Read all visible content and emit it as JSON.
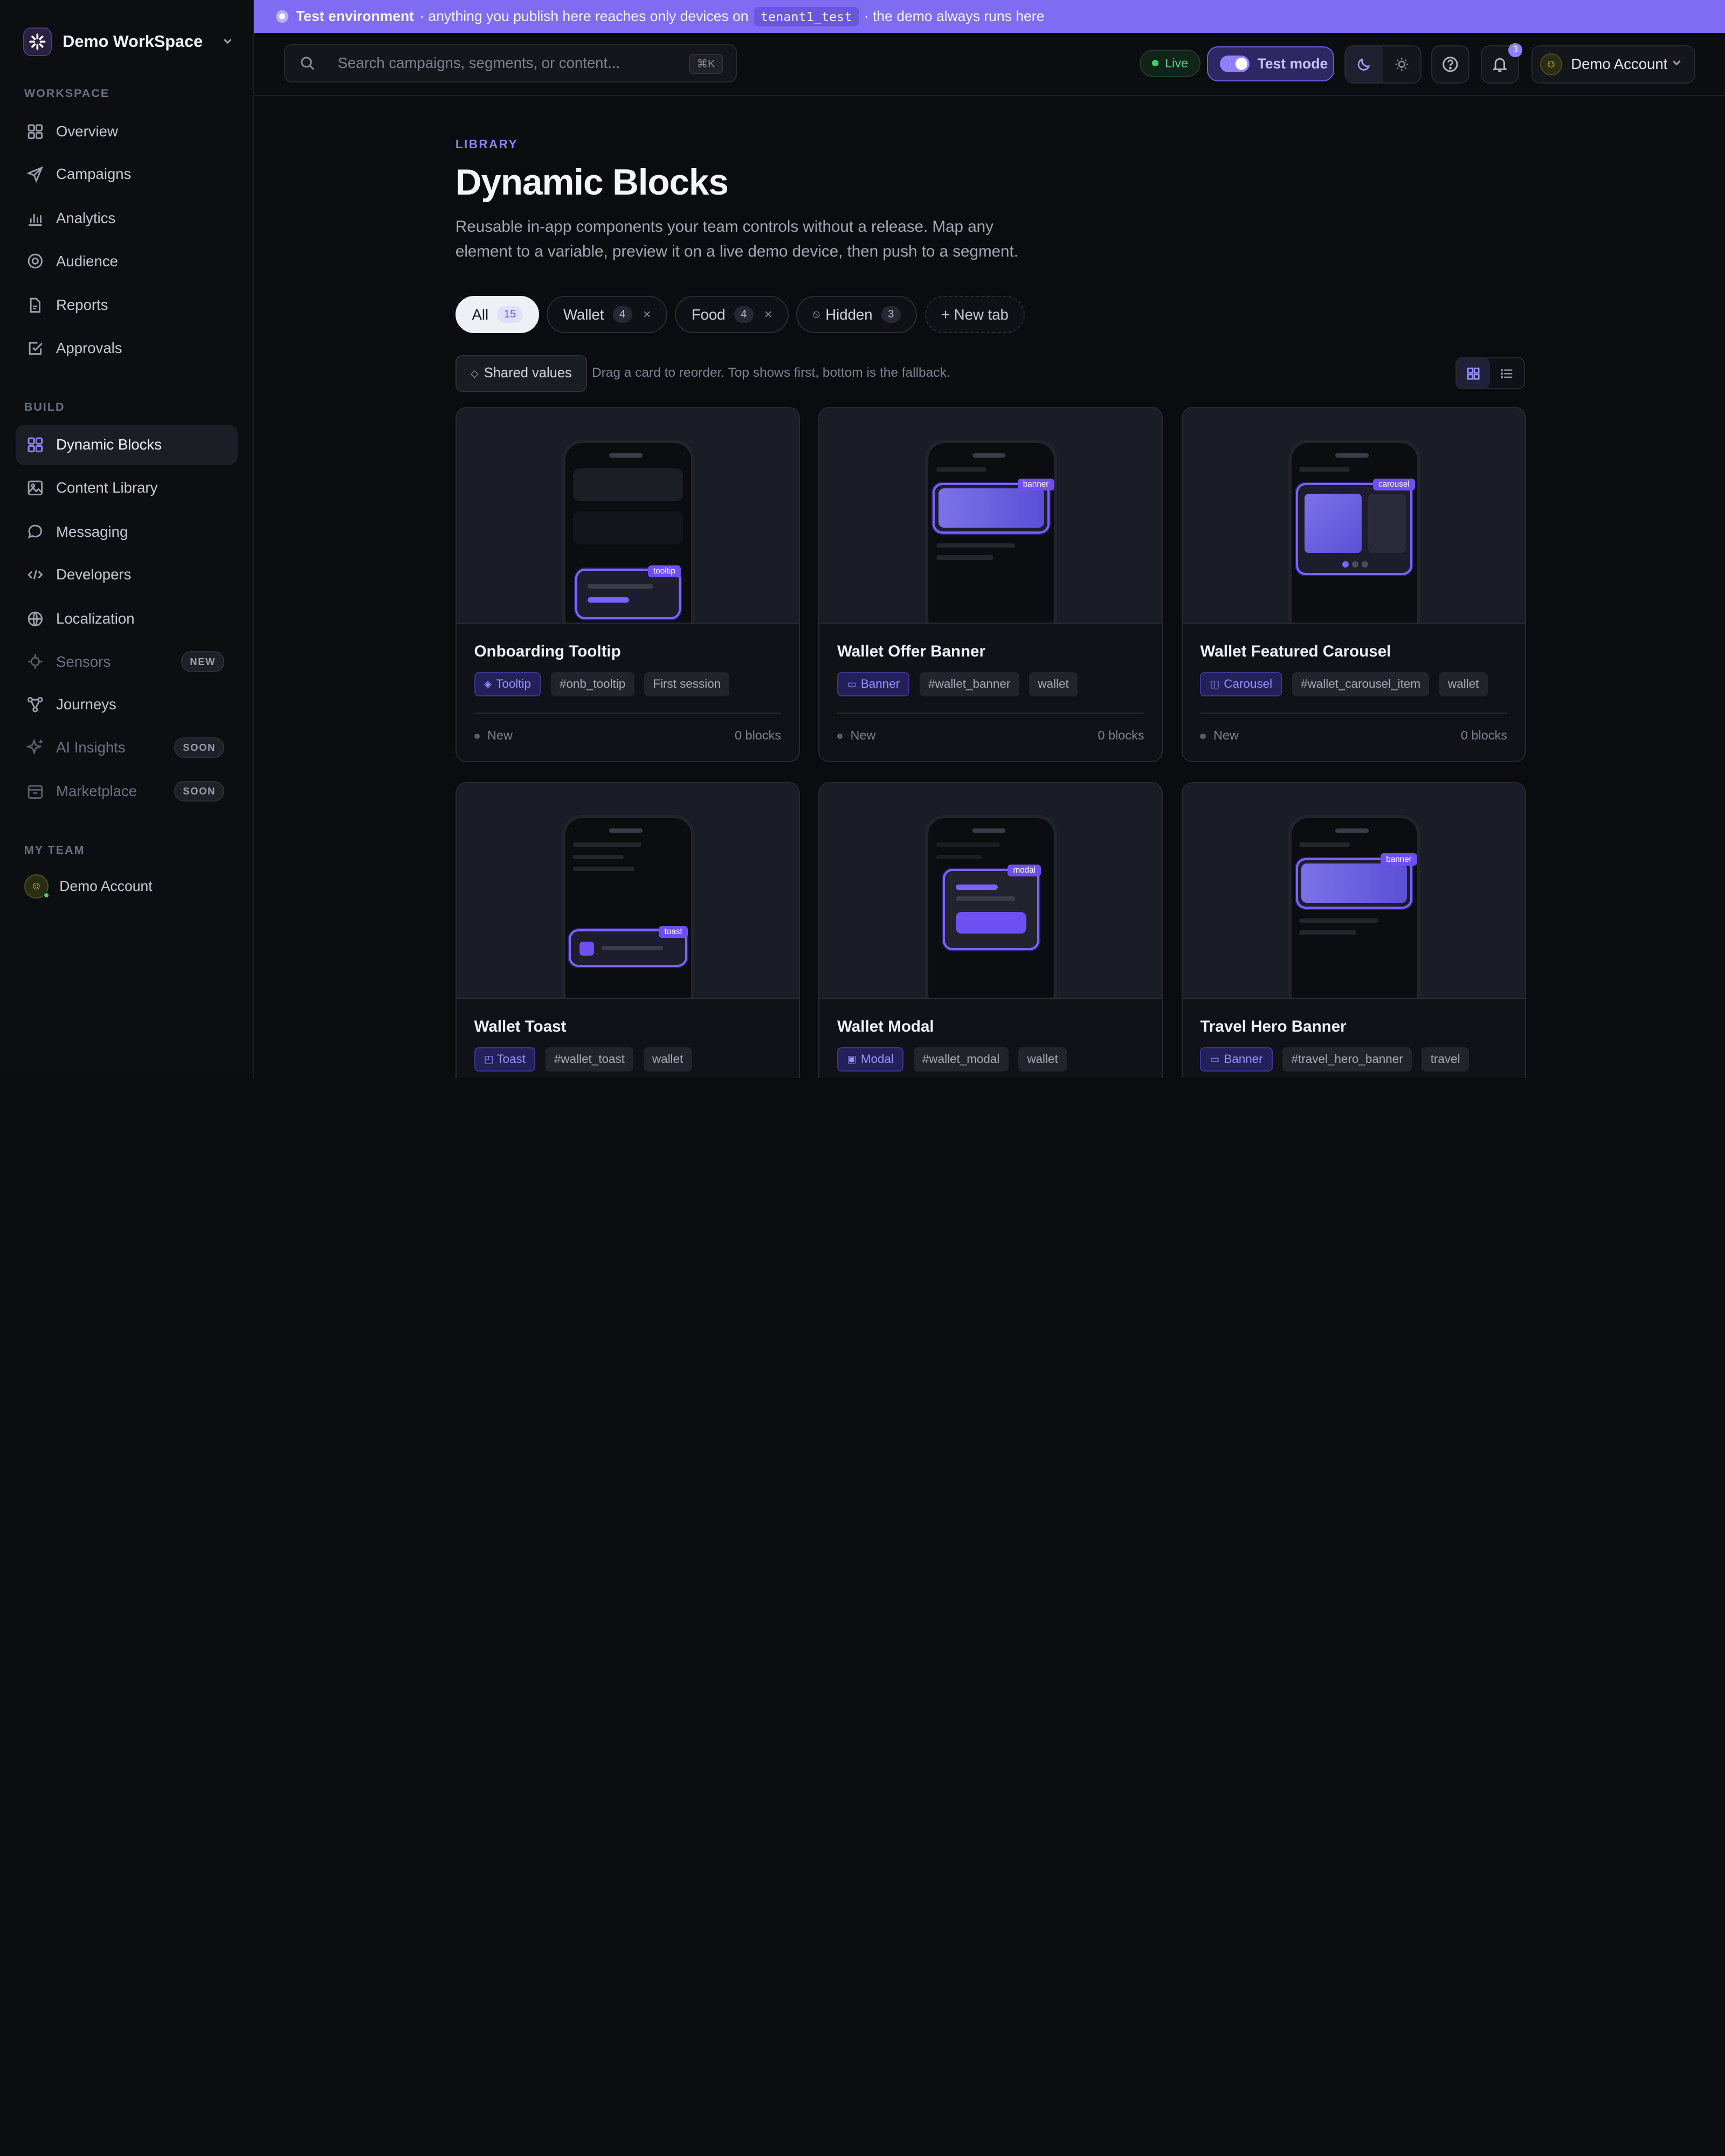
{
  "workspace": {
    "name": "Demo WorkSpace"
  },
  "sidebar": {
    "sections": {
      "workspace": "WORKSPACE",
      "build": "BUILD",
      "team": "MY TEAM"
    },
    "workspace_items": [
      {
        "label": "Overview",
        "icon": "grid-icon"
      },
      {
        "label": "Campaigns",
        "icon": "send-icon"
      },
      {
        "label": "Analytics",
        "icon": "bar-chart-icon"
      },
      {
        "label": "Audience",
        "icon": "target-icon"
      },
      {
        "label": "Reports",
        "icon": "file-icon"
      },
      {
        "label": "Approvals",
        "icon": "check-square-icon"
      }
    ],
    "build_items": [
      {
        "label": "Dynamic Blocks",
        "icon": "grid-icon",
        "active": true
      },
      {
        "label": "Content Library",
        "icon": "image-icon"
      },
      {
        "label": "Messaging",
        "icon": "chat-icon"
      },
      {
        "label": "Developers",
        "icon": "code-icon"
      },
      {
        "label": "Localization",
        "icon": "globe-icon"
      },
      {
        "label": "Sensors",
        "icon": "sensor-icon",
        "badge": "NEW"
      },
      {
        "label": "Journeys",
        "icon": "journey-icon"
      },
      {
        "label": "AI Insights",
        "icon": "sparkle-icon",
        "badge": "SOON"
      },
      {
        "label": "Marketplace",
        "icon": "store-icon",
        "badge": "SOON"
      }
    ],
    "team_member": "Demo Account"
  },
  "banner": {
    "bold": "Test environment",
    "text": "· anything you publish here reaches only devices on",
    "code": "tenant1_test",
    "suffix": "· the demo always runs here"
  },
  "topbar": {
    "search_placeholder": "Search campaigns, segments, or content...",
    "search_shortcut": "⌘K",
    "live": "Live",
    "test_mode": "Test mode",
    "notifications": "3",
    "account": "Demo Account"
  },
  "page": {
    "eyebrow": "LIBRARY",
    "title": "Dynamic Blocks",
    "description": "Reusable in-app components your team controls without a release. Map any element to a variable, preview it on a live demo device, then push to a segment."
  },
  "tabs": [
    {
      "label": "All",
      "count": "15",
      "active": true
    },
    {
      "label": "Wallet",
      "count": "4",
      "closable": true
    },
    {
      "label": "Food",
      "count": "4",
      "closable": true
    },
    {
      "label": "Hidden",
      "count": "3",
      "icon": "hidden-icon"
    }
  ],
  "new_tab": "+ New tab",
  "shared_values": "Shared values",
  "reorder_hint": "Drag a card to reorder. Top shows first, bottom is the fallback.",
  "cards": [
    {
      "title": "Onboarding Tooltip",
      "type": "Tooltip",
      "key": "#onb_tooltip",
      "tag": "First session",
      "status": "New",
      "blocks": "0 blocks",
      "preview_label": "tooltip"
    },
    {
      "title": "Wallet Offer Banner",
      "type": "Banner",
      "key": "#wallet_banner",
      "tag": "wallet",
      "status": "New",
      "blocks": "0 blocks",
      "preview_label": "banner"
    },
    {
      "title": "Wallet Featured Carousel",
      "type": "Carousel",
      "key": "#wallet_carousel_item",
      "tag": "wallet",
      "status": "New",
      "blocks": "0 blocks",
      "preview_label": "carousel"
    },
    {
      "title": "Wallet Toast",
      "type": "Toast",
      "key": "#wallet_toast",
      "tag": "wallet",
      "status": "",
      "blocks": "",
      "preview_label": "toast"
    },
    {
      "title": "Wallet Modal",
      "type": "Modal",
      "key": "#wallet_modal",
      "tag": "wallet",
      "status": "",
      "blocks": "",
      "preview_label": "modal"
    },
    {
      "title": "Travel Hero Banner",
      "type": "Banner",
      "key": "#travel_hero_banner",
      "tag": "travel",
      "status": "",
      "blocks": "",
      "preview_label": "banner"
    }
  ],
  "colors": {
    "accent": "#7f6cf2",
    "banner_bg": "#7f6cf2",
    "live_green": "#3bd16f",
    "bg": "#0b0c10"
  }
}
